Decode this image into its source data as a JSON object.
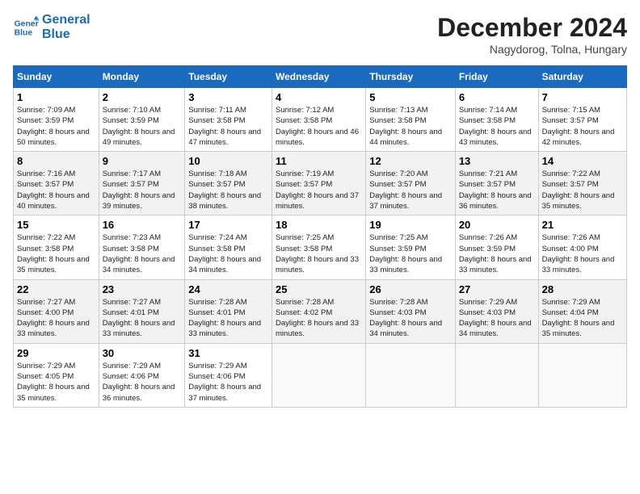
{
  "header": {
    "logo_line1": "General",
    "logo_line2": "Blue",
    "title": "December 2024",
    "subtitle": "Nagydorog, Tolna, Hungary"
  },
  "columns": [
    "Sunday",
    "Monday",
    "Tuesday",
    "Wednesday",
    "Thursday",
    "Friday",
    "Saturday"
  ],
  "weeks": [
    [
      {
        "day": "1",
        "sunrise": "Sunrise: 7:09 AM",
        "sunset": "Sunset: 3:59 PM",
        "daylight": "Daylight: 8 hours and 50 minutes."
      },
      {
        "day": "2",
        "sunrise": "Sunrise: 7:10 AM",
        "sunset": "Sunset: 3:59 PM",
        "daylight": "Daylight: 8 hours and 49 minutes."
      },
      {
        "day": "3",
        "sunrise": "Sunrise: 7:11 AM",
        "sunset": "Sunset: 3:58 PM",
        "daylight": "Daylight: 8 hours and 47 minutes."
      },
      {
        "day": "4",
        "sunrise": "Sunrise: 7:12 AM",
        "sunset": "Sunset: 3:58 PM",
        "daylight": "Daylight: 8 hours and 46 minutes."
      },
      {
        "day": "5",
        "sunrise": "Sunrise: 7:13 AM",
        "sunset": "Sunset: 3:58 PM",
        "daylight": "Daylight: 8 hours and 44 minutes."
      },
      {
        "day": "6",
        "sunrise": "Sunrise: 7:14 AM",
        "sunset": "Sunset: 3:58 PM",
        "daylight": "Daylight: 8 hours and 43 minutes."
      },
      {
        "day": "7",
        "sunrise": "Sunrise: 7:15 AM",
        "sunset": "Sunset: 3:57 PM",
        "daylight": "Daylight: 8 hours and 42 minutes."
      }
    ],
    [
      {
        "day": "8",
        "sunrise": "Sunrise: 7:16 AM",
        "sunset": "Sunset: 3:57 PM",
        "daylight": "Daylight: 8 hours and 40 minutes."
      },
      {
        "day": "9",
        "sunrise": "Sunrise: 7:17 AM",
        "sunset": "Sunset: 3:57 PM",
        "daylight": "Daylight: 8 hours and 39 minutes."
      },
      {
        "day": "10",
        "sunrise": "Sunrise: 7:18 AM",
        "sunset": "Sunset: 3:57 PM",
        "daylight": "Daylight: 8 hours and 38 minutes."
      },
      {
        "day": "11",
        "sunrise": "Sunrise: 7:19 AM",
        "sunset": "Sunset: 3:57 PM",
        "daylight": "Daylight: 8 hours and 37 minutes."
      },
      {
        "day": "12",
        "sunrise": "Sunrise: 7:20 AM",
        "sunset": "Sunset: 3:57 PM",
        "daylight": "Daylight: 8 hours and 37 minutes."
      },
      {
        "day": "13",
        "sunrise": "Sunrise: 7:21 AM",
        "sunset": "Sunset: 3:57 PM",
        "daylight": "Daylight: 8 hours and 36 minutes."
      },
      {
        "day": "14",
        "sunrise": "Sunrise: 7:22 AM",
        "sunset": "Sunset: 3:57 PM",
        "daylight": "Daylight: 8 hours and 35 minutes."
      }
    ],
    [
      {
        "day": "15",
        "sunrise": "Sunrise: 7:22 AM",
        "sunset": "Sunset: 3:58 PM",
        "daylight": "Daylight: 8 hours and 35 minutes."
      },
      {
        "day": "16",
        "sunrise": "Sunrise: 7:23 AM",
        "sunset": "Sunset: 3:58 PM",
        "daylight": "Daylight: 8 hours and 34 minutes."
      },
      {
        "day": "17",
        "sunrise": "Sunrise: 7:24 AM",
        "sunset": "Sunset: 3:58 PM",
        "daylight": "Daylight: 8 hours and 34 minutes."
      },
      {
        "day": "18",
        "sunrise": "Sunrise: 7:25 AM",
        "sunset": "Sunset: 3:58 PM",
        "daylight": "Daylight: 8 hours and 33 minutes."
      },
      {
        "day": "19",
        "sunrise": "Sunrise: 7:25 AM",
        "sunset": "Sunset: 3:59 PM",
        "daylight": "Daylight: 8 hours and 33 minutes."
      },
      {
        "day": "20",
        "sunrise": "Sunrise: 7:26 AM",
        "sunset": "Sunset: 3:59 PM",
        "daylight": "Daylight: 8 hours and 33 minutes."
      },
      {
        "day": "21",
        "sunrise": "Sunrise: 7:26 AM",
        "sunset": "Sunset: 4:00 PM",
        "daylight": "Daylight: 8 hours and 33 minutes."
      }
    ],
    [
      {
        "day": "22",
        "sunrise": "Sunrise: 7:27 AM",
        "sunset": "Sunset: 4:00 PM",
        "daylight": "Daylight: 8 hours and 33 minutes."
      },
      {
        "day": "23",
        "sunrise": "Sunrise: 7:27 AM",
        "sunset": "Sunset: 4:01 PM",
        "daylight": "Daylight: 8 hours and 33 minutes."
      },
      {
        "day": "24",
        "sunrise": "Sunrise: 7:28 AM",
        "sunset": "Sunset: 4:01 PM",
        "daylight": "Daylight: 8 hours and 33 minutes."
      },
      {
        "day": "25",
        "sunrise": "Sunrise: 7:28 AM",
        "sunset": "Sunset: 4:02 PM",
        "daylight": "Daylight: 8 hours and 33 minutes."
      },
      {
        "day": "26",
        "sunrise": "Sunrise: 7:28 AM",
        "sunset": "Sunset: 4:03 PM",
        "daylight": "Daylight: 8 hours and 34 minutes."
      },
      {
        "day": "27",
        "sunrise": "Sunrise: 7:29 AM",
        "sunset": "Sunset: 4:03 PM",
        "daylight": "Daylight: 8 hours and 34 minutes."
      },
      {
        "day": "28",
        "sunrise": "Sunrise: 7:29 AM",
        "sunset": "Sunset: 4:04 PM",
        "daylight": "Daylight: 8 hours and 35 minutes."
      }
    ],
    [
      {
        "day": "29",
        "sunrise": "Sunrise: 7:29 AM",
        "sunset": "Sunset: 4:05 PM",
        "daylight": "Daylight: 8 hours and 35 minutes."
      },
      {
        "day": "30",
        "sunrise": "Sunrise: 7:29 AM",
        "sunset": "Sunset: 4:06 PM",
        "daylight": "Daylight: 8 hours and 36 minutes."
      },
      {
        "day": "31",
        "sunrise": "Sunrise: 7:29 AM",
        "sunset": "Sunset: 4:06 PM",
        "daylight": "Daylight: 8 hours and 37 minutes."
      },
      null,
      null,
      null,
      null
    ]
  ]
}
